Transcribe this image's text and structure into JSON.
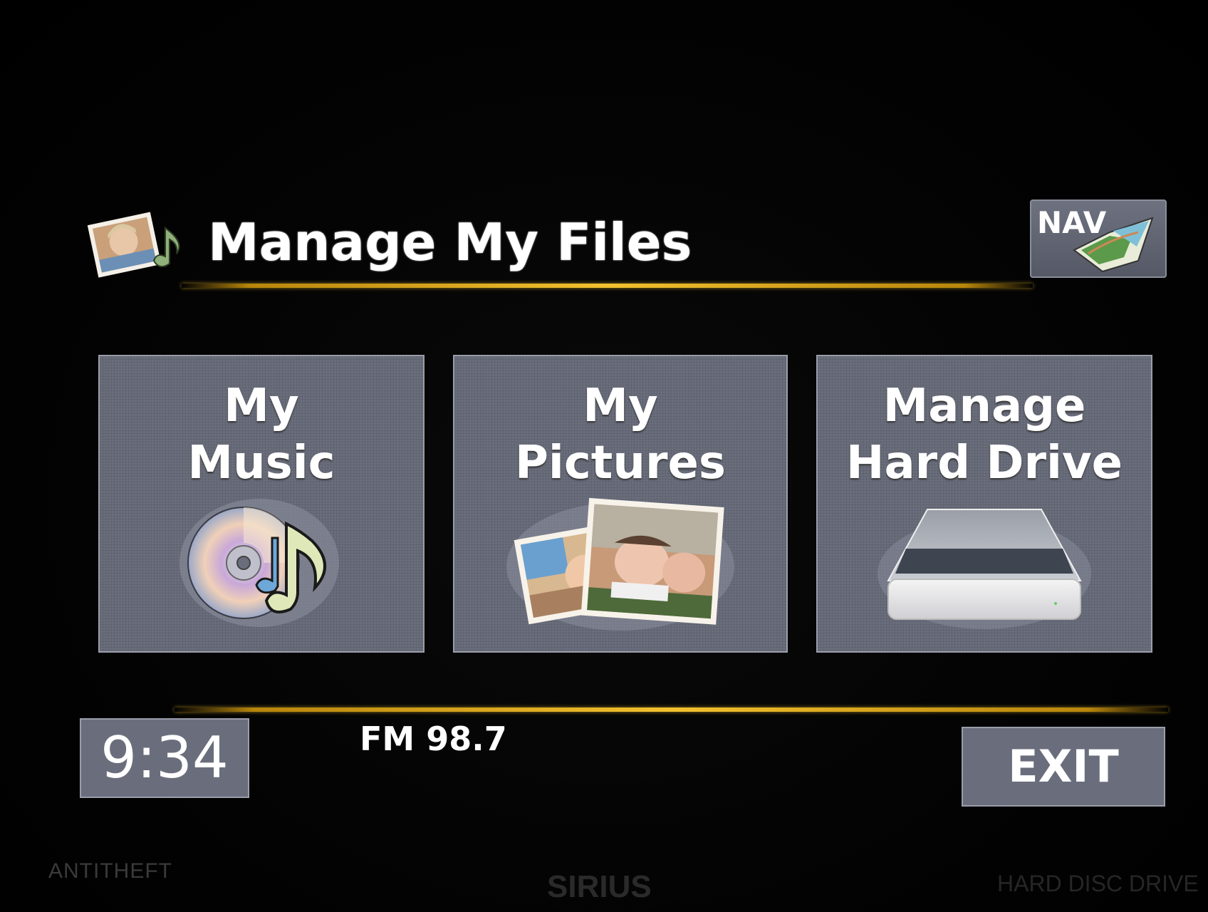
{
  "header": {
    "title": "Manage My Files",
    "nav_label": "NAV"
  },
  "tiles": [
    {
      "line1": "My",
      "line2": "Music",
      "icon": "music-disc-icon"
    },
    {
      "line1": "My",
      "line2": "Pictures",
      "icon": "photos-icon"
    },
    {
      "line1": "Manage",
      "line2": "Hard Drive",
      "icon": "hard-drive-icon"
    }
  ],
  "footer": {
    "clock": "9:34",
    "radio": "FM 98.7",
    "exit_label": "EXIT"
  },
  "bezel": {
    "left": "ANTITHEFT",
    "center": "SIRIUS",
    "right": "HARD DISC DRIVE"
  },
  "colors": {
    "accent_line": "#f2c12e",
    "tile_bg": "#6a6e7c",
    "background": "#000000"
  }
}
